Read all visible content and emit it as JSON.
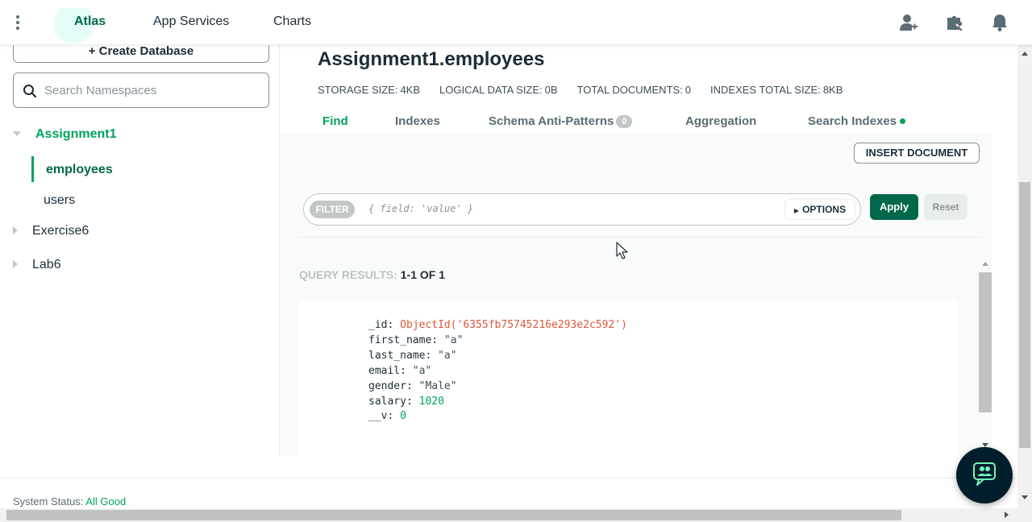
{
  "nav": {
    "tabs": [
      {
        "label": "Atlas",
        "active": true
      },
      {
        "label": "App Services",
        "active": false
      },
      {
        "label": "Charts",
        "active": false
      }
    ],
    "icons": [
      "user-plus-icon",
      "puzzle-icon",
      "bell-icon"
    ]
  },
  "sidebar": {
    "create_label": "+ Create Database",
    "search_placeholder": "Search Namespaces",
    "databases": [
      {
        "name": "Assignment1",
        "expanded": true,
        "collections": [
          {
            "name": "employees",
            "active": true
          },
          {
            "name": "users",
            "active": false
          }
        ]
      },
      {
        "name": "Exercise6",
        "expanded": false
      },
      {
        "name": "Lab6",
        "expanded": false
      }
    ]
  },
  "main": {
    "title": "Assignment1.employees",
    "stats": [
      {
        "label": "STORAGE SIZE:",
        "value": "4KB"
      },
      {
        "label": "LOGICAL DATA SIZE:",
        "value": "0B"
      },
      {
        "label": "TOTAL DOCUMENTS:",
        "value": "0"
      },
      {
        "label": "INDEXES TOTAL SIZE:",
        "value": "8KB"
      }
    ],
    "tabs": [
      {
        "label": "Find",
        "active": true
      },
      {
        "label": "Indexes",
        "active": false
      },
      {
        "label": "Schema Anti-Patterns",
        "badge": "0"
      },
      {
        "label": "Aggregation",
        "active": false
      },
      {
        "label": "Search Indexes",
        "indicator": true
      }
    ],
    "insert_label": "INSERT DOCUMENT",
    "filter": {
      "pill": "FILTER",
      "placeholder": "{ field: 'value' }",
      "options_label": "OPTIONS",
      "apply_label": "Apply",
      "reset_label": "Reset"
    },
    "results": {
      "label": "QUERY RESULTS:",
      "range": "1-1 OF 1"
    },
    "document": {
      "id_key": "_id:",
      "id_value": "ObjectId('6355fb75745216e293e2c592')",
      "fields": [
        {
          "key": "first_name:",
          "value": "\"a\"",
          "kind": "str"
        },
        {
          "key": "last_name:",
          "value": "\"a\"",
          "kind": "str"
        },
        {
          "key": "email:",
          "value": "\"a\"",
          "kind": "str"
        },
        {
          "key": "gender:",
          "value": "\"Male\"",
          "kind": "str"
        },
        {
          "key": "salary:",
          "value": "1020",
          "kind": "num"
        },
        {
          "key": "__v:",
          "value": "0",
          "kind": "num"
        }
      ]
    }
  },
  "footer": {
    "status_label": "System Status:",
    "status_value": "All Good"
  },
  "colors": {
    "brand_green": "#00a35c",
    "dark_green": "#00684a",
    "objectid_red": "#e0553a",
    "chat_bg": "#001e2b"
  }
}
